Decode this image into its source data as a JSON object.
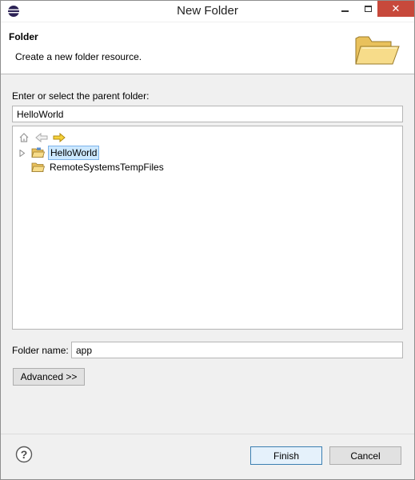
{
  "window": {
    "title": "New Folder",
    "close_glyph": "✕"
  },
  "banner": {
    "title": "Folder",
    "description": "Create a new folder resource.",
    "icon": "open-folder-icon"
  },
  "parent": {
    "label": "Enter or select the parent folder:",
    "value": "HelloWorld"
  },
  "tree": {
    "toolbar": [
      {
        "icon": "home-icon",
        "enabled": false
      },
      {
        "icon": "back-arrow-icon",
        "enabled": false
      },
      {
        "icon": "forward-arrow-icon",
        "enabled": true
      }
    ],
    "items": [
      {
        "label": "HelloWorld",
        "expandable": true,
        "selected": true
      },
      {
        "label": "RemoteSystemsTempFiles",
        "expandable": false,
        "selected": false
      }
    ]
  },
  "folder_name": {
    "label": "Folder name:",
    "value": "app"
  },
  "buttons": {
    "advanced": "Advanced >>",
    "finish": "Finish",
    "cancel": "Cancel",
    "help_glyph": "?"
  },
  "colors": {
    "accent_blue": "#3c7fb1",
    "selection": "#cce8ff",
    "folder_yellow": "#f2d27a",
    "close_red": "#c7493b"
  }
}
